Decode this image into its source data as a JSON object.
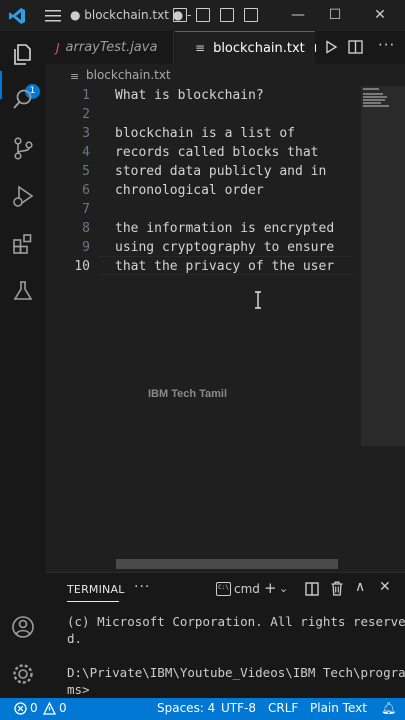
{
  "window": {
    "title": "● blockchain.txt ● -"
  },
  "activity_bar": {
    "items": [
      "explorer-icon",
      "search-icon",
      "source-control-icon",
      "run-debug-icon",
      "extensions-icon",
      "testing-icon"
    ],
    "explorer_badge": "1",
    "bottom": [
      "account-icon",
      "manage-gear-icon"
    ]
  },
  "tabs": [
    {
      "label": "arrayTest.java",
      "icon": "J",
      "active": false
    },
    {
      "label": "blockchain.txt",
      "icon": "≡",
      "active": true,
      "dirty": true
    }
  ],
  "breadcrumb": {
    "file": "blockchain.txt"
  },
  "editor": {
    "line_numbers": [
      "1",
      "2",
      "3",
      "4",
      "5",
      "6",
      "7",
      "8",
      "9",
      "10"
    ],
    "lines": [
      "What is blockchain?",
      "",
      "blockchain is a list of",
      "records called blocks that",
      "stored data publicly and in",
      "chronological order",
      "",
      "the information is encrypted",
      "using cryptography to ensure",
      "that the privacy of the user"
    ],
    "active_line": "10",
    "watermark": "IBM Tech Tamil"
  },
  "panel": {
    "tab": "TERMINAL",
    "more": "···",
    "terminal_name": "cmd",
    "output": [
      "(c) Microsoft Corporation. All rights reserve",
      "d.",
      "",
      "D:\\Private\\IBM\\Youtube_Videos\\IBM Tech\\progra",
      "ms>"
    ]
  },
  "status_bar": {
    "errors": "0",
    "warnings": "0",
    "spaces": "Spaces: 4",
    "encoding": "UTF-8",
    "eol": "CRLF",
    "language": "Plain Text"
  },
  "colors": {
    "accent": "#0078d4",
    "java_icon": "#f14c4c",
    "editor_bg": "#1f1f1f",
    "activity_bg": "#181818"
  }
}
